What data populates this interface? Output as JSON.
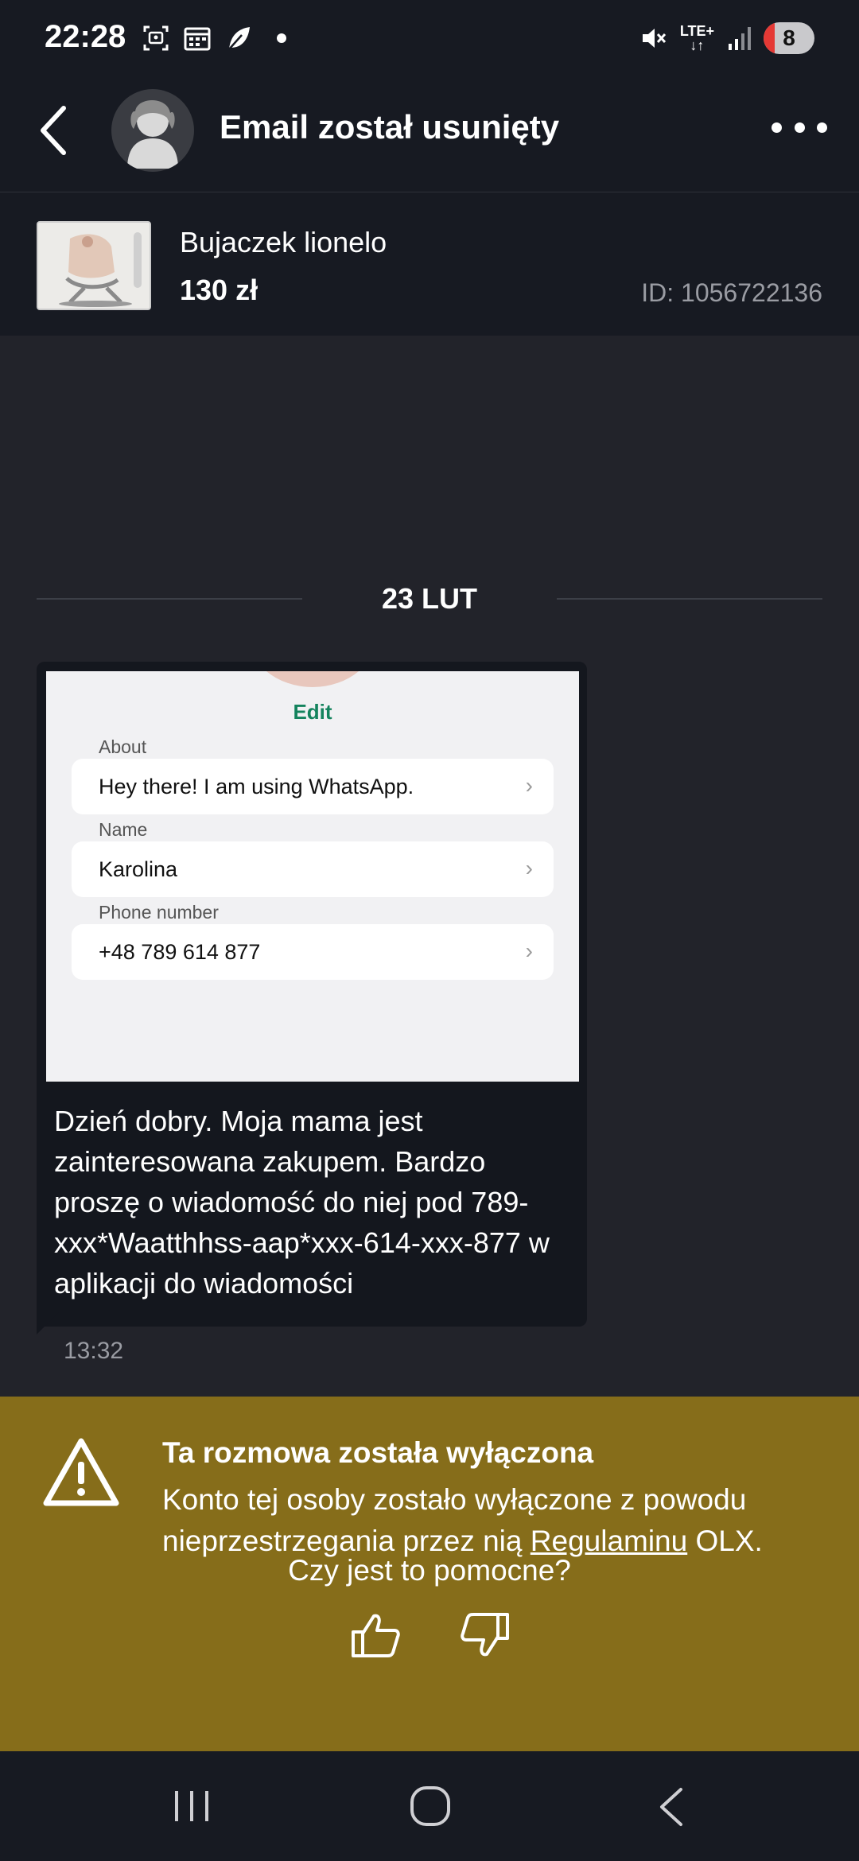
{
  "status_bar": {
    "time": "22:28",
    "network": "LTE+",
    "battery_level": "8",
    "icons": [
      "screenshot-icon",
      "calendar-icon",
      "leaf-icon",
      "notification-dot",
      "mute-icon",
      "signal-icon",
      "battery-icon"
    ]
  },
  "header": {
    "title": "Email został usunięty",
    "back_icon": "back-arrow-icon",
    "menu_icon": "more-options-icon"
  },
  "listing": {
    "title": "Bujaczek lionelo",
    "price": "130 zł",
    "id": "ID: 1056722136"
  },
  "conversation": {
    "date_separator": "23 LUT",
    "message": {
      "attachment": {
        "edit_label": "Edit",
        "about_label": "About",
        "about_value": "Hey there! I am using WhatsApp.",
        "name_label": "Name",
        "name_value": "Karolina",
        "phone_label": "Phone number",
        "phone_value": "+48 789 614 877"
      },
      "text": "Dzień dobry. Moja mama jest zainteresowana  zakupem. Bardzo proszę o wiadomość do niej  pod 789-xxx*Waatthhss-aap*xxx-614-xxx-877 w aplikacji  do wiadomości",
      "time": "13:32"
    }
  },
  "banner": {
    "title": "Ta rozmowa została wyłączona",
    "body_before": "Konto tej osoby zostało wyłączone z powodu nieprzestrzegania przez nią ",
    "link": "Regulaminu",
    "body_after": " OLX.",
    "helpful_question": "Czy jest to pomocne?",
    "warning_icon": "warning-icon",
    "colors": {
      "background": "#866d1a"
    }
  },
  "nav_bar": {
    "icons": [
      "recent-apps-icon",
      "home-icon",
      "back-icon"
    ]
  }
}
